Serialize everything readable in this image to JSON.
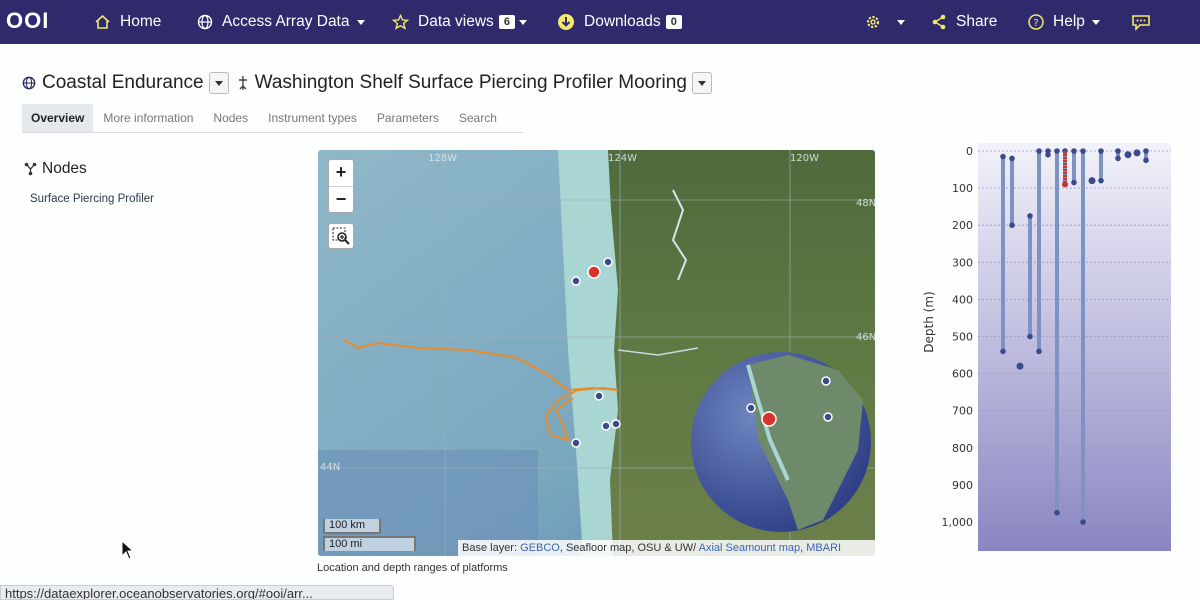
{
  "nav": {
    "logo": "OOI",
    "home": "Home",
    "access": "Access Array Data",
    "dataviews": "Data views",
    "dataviews_count": "6",
    "downloads": "Downloads",
    "downloads_count": "0",
    "share": "Share",
    "help": "Help"
  },
  "page": {
    "array": "Coastal Endurance",
    "site": "Washington Shelf Surface Piercing Profiler Mooring"
  },
  "tabs": [
    "Overview",
    "More information",
    "Nodes",
    "Instrument types",
    "Parameters",
    "Search"
  ],
  "nodes": {
    "heading": "Nodes",
    "items": [
      "Surface Piercing Profiler"
    ]
  },
  "map": {
    "zoom_in": "+",
    "zoom_out": "−",
    "lon_labels": [
      "128W",
      "124W",
      "120W"
    ],
    "lat_labels": [
      "48N",
      "46N",
      "44N"
    ],
    "scale_km": "100 km",
    "scale_mi": "100 mi",
    "attribution_prefix": "Base layer: ",
    "attribution_gebco": "GEBCO",
    "attribution_mid": ", Seafloor map, OSU & UW/ ",
    "attribution_axial": "Axial Seamount map",
    "attribution_sep": ", ",
    "attribution_mbari": "MBARI",
    "caption": "Location and depth ranges of platforms"
  },
  "depth_chart": {
    "ylabel": "Depth (m)",
    "ticks": [
      "0",
      "100",
      "200",
      "300",
      "400",
      "500",
      "600",
      "700",
      "800",
      "900",
      "1,000"
    ]
  },
  "chart_data": {
    "type": "scatter",
    "title": "",
    "ylabel": "Depth (m)",
    "ylim": [
      0,
      1000
    ],
    "y_inverted": true,
    "series": [
      {
        "kind": "range",
        "values": [
          [
            15,
            540
          ],
          [
            20,
            200
          ],
          [
            175,
            500
          ],
          [
            0,
            540
          ],
          [
            0,
            975
          ],
          [
            0,
            1000
          ],
          [
            0,
            10
          ],
          [
            0,
            90
          ],
          [
            0,
            85
          ],
          [
            0,
            80
          ],
          [
            0,
            20
          ],
          [
            0,
            25
          ]
        ]
      },
      {
        "kind": "highlight",
        "color": "#c0392b",
        "values": [
          [
            0,
            90
          ]
        ]
      },
      {
        "kind": "point",
        "values": [
          580,
          80,
          10,
          5
        ]
      }
    ],
    "colors": {
      "range": "#7f93c2",
      "point": "#3c4a8c",
      "highlight": "#c0392b"
    }
  },
  "status": {
    "url": "https://dataexplorer.oceanobservatories.org/#ooi/arr..."
  }
}
